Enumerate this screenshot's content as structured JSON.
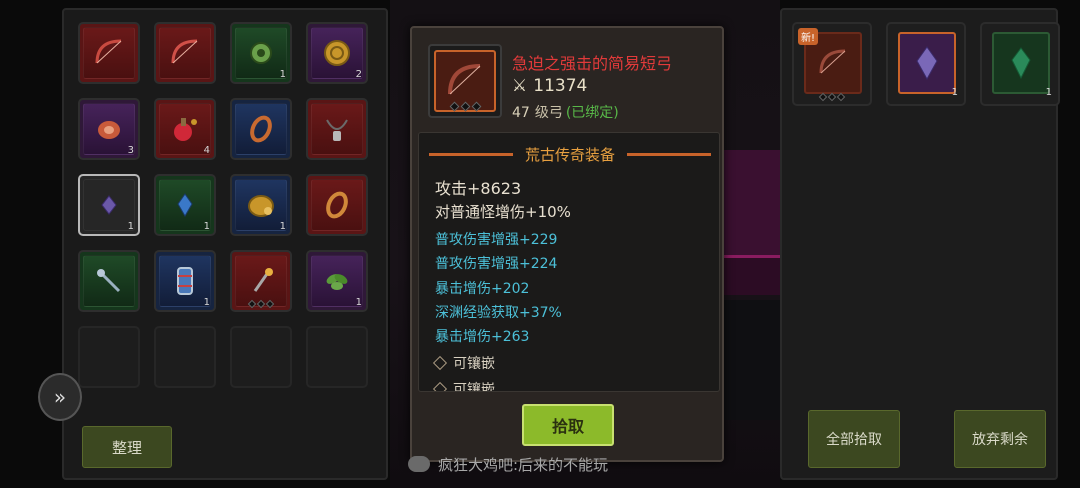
{
  "inventory": {
    "slots": [
      {
        "icon": "bow-icon",
        "rarity": "red",
        "count": ""
      },
      {
        "icon": "bow-icon",
        "rarity": "red",
        "count": ""
      },
      {
        "icon": "green-orb-icon",
        "rarity": "green",
        "count": "1"
      },
      {
        "icon": "gold-coin-icon",
        "rarity": "purple",
        "count": "2"
      },
      {
        "icon": "meat-icon",
        "rarity": "purple",
        "count": "3"
      },
      {
        "icon": "potion-icon",
        "rarity": "red",
        "count": "4"
      },
      {
        "icon": "ring-icon",
        "rarity": "blue",
        "count": ""
      },
      {
        "icon": "necklace-icon",
        "rarity": "red",
        "count": ""
      },
      {
        "icon": "purple-crystal-icon",
        "rarity": "white",
        "count": "1"
      },
      {
        "icon": "blue-crystal-icon",
        "rarity": "green",
        "count": "1"
      },
      {
        "icon": "gold-pouch-icon",
        "rarity": "blue",
        "count": "1"
      },
      {
        "icon": "ring-icon",
        "rarity": "red",
        "count": ""
      },
      {
        "icon": "staff-icon",
        "rarity": "green",
        "count": ""
      },
      {
        "icon": "scroll-icon",
        "rarity": "blue",
        "count": "1"
      },
      {
        "icon": "staff-icon",
        "rarity": "red",
        "count": ""
      },
      {
        "icon": "herb-icon",
        "rarity": "purple",
        "count": "1"
      }
    ],
    "sort_label": "整理"
  },
  "tooltip": {
    "item_name": "急迫之强击的简易短弓",
    "power": "11374",
    "level": "47",
    "weapon_type": "级弓",
    "bound": "(已绑定)",
    "section_title": "荒古传奇装备",
    "main_stats": [
      "攻击+8623",
      "对普通怪增伤+10%"
    ],
    "sub_stats": [
      "普攻伤害增强+229",
      "普攻伤害增强+224",
      "暴击增伤+202",
      "深渊经验获取+37%",
      "暴击增伤+263"
    ],
    "sockets": [
      "可镶嵌",
      "可镶嵌"
    ],
    "pick_label": "拾取"
  },
  "loot": {
    "new_badge": "新!",
    "items": [
      {
        "icon": "bow-icon",
        "count": ""
      },
      {
        "icon": "purple-crystal-icon",
        "count": "1"
      },
      {
        "icon": "green-crystal-icon",
        "count": "1"
      }
    ],
    "pick_all_label": "全部拾取",
    "discard_label": "放弃剩余"
  },
  "chat": {
    "text": "疯狂大鸡吧:后来的不能玩"
  },
  "colors": {
    "legendary_red": "#e23a3a",
    "legendary_orange": "#c8632a",
    "stat_blue": "#4cc0d8",
    "bound_green": "#58b848",
    "button_green": "#8cba2a"
  }
}
